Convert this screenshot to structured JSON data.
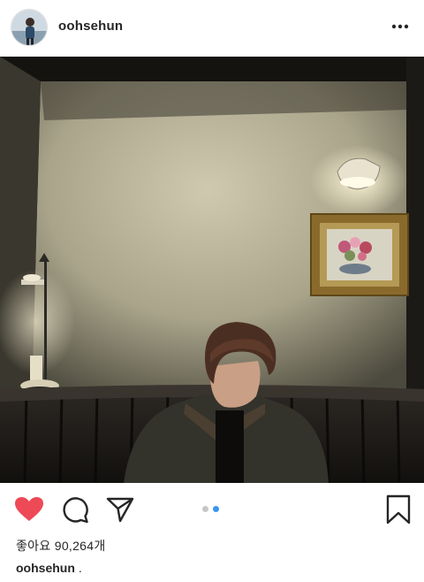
{
  "post": {
    "username": "oohsehun",
    "likes_label": "좋아요 90,264개",
    "caption_user": "oohsehun",
    "caption_text": "."
  },
  "carousel": {
    "count": 2,
    "active_index": 1
  },
  "colors": {
    "like_red": "#ed4956",
    "dot_active": "#3897f0",
    "dot_inactive": "#c7c7c7"
  },
  "icons": [
    "more-icon",
    "heart-icon",
    "comment-icon",
    "share-icon",
    "bookmark-icon"
  ]
}
